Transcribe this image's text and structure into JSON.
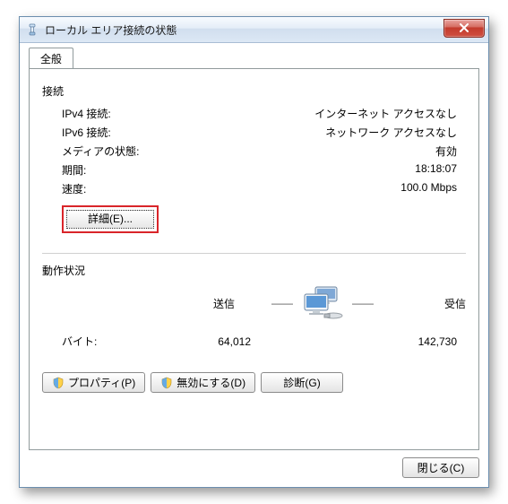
{
  "window": {
    "title": "ローカル エリア接続の状態"
  },
  "tab": {
    "general": "全般"
  },
  "connection": {
    "section": "接続",
    "ipv4_label": "IPv4 接続:",
    "ipv4_value": "インターネット アクセスなし",
    "ipv6_label": "IPv6 接続:",
    "ipv6_value": "ネットワーク アクセスなし",
    "media_label": "メディアの状態:",
    "media_value": "有効",
    "duration_label": "期間:",
    "duration_value": "18:18:07",
    "speed_label": "速度:",
    "speed_value": "100.0 Mbps",
    "details_button": "詳細(E)..."
  },
  "activity": {
    "section": "動作状況",
    "sent_label": "送信",
    "received_label": "受信",
    "bytes_label": "バイト:",
    "sent_value": "64,012",
    "received_value": "142,730"
  },
  "buttons": {
    "properties": "プロパティ(P)",
    "disable": "無効にする(D)",
    "diagnose": "診断(G)",
    "close": "閉じる(C)"
  }
}
